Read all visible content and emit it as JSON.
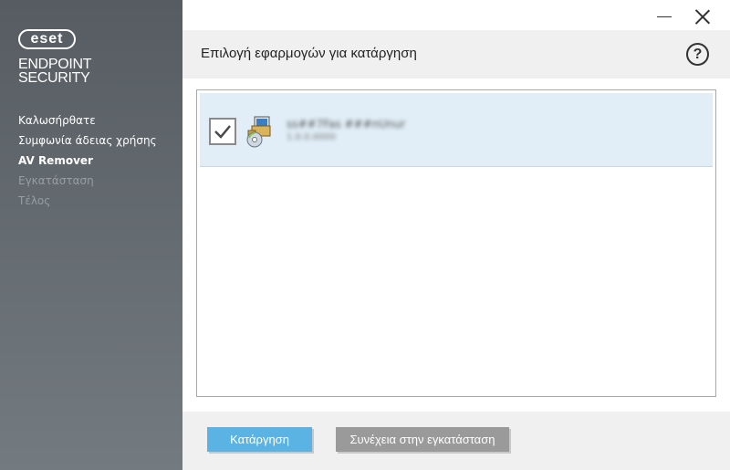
{
  "sidebar": {
    "logo": {
      "badge": "eset",
      "line1": "ENDPOINT",
      "line2": "SECURITY"
    },
    "steps": [
      {
        "label": "Καλωσήρθατε",
        "state": "done"
      },
      {
        "label": "Συμφωνία άδειας χρήσης",
        "state": "done"
      },
      {
        "label": "AV Remover",
        "state": "current"
      },
      {
        "label": "Εγκατάσταση",
        "state": "inactive"
      },
      {
        "label": "Τέλος",
        "state": "inactive"
      }
    ]
  },
  "window": {
    "minimize_icon": "minimize-icon",
    "close_icon": "close-icon"
  },
  "header": {
    "title": "Επιλογή εφαρμογών για κατάργηση",
    "help_glyph": "?"
  },
  "app_list": {
    "items": [
      {
        "name": "ss##7Fas ###nUnur",
        "version": "1.0.0.0000",
        "checked": true,
        "icon": "installer-package-icon"
      }
    ]
  },
  "footer": {
    "remove_label": "Κατάργηση",
    "continue_label": "Συνέχεια στην εγκατάσταση"
  },
  "colors": {
    "sidebar_top": "#565c62",
    "sidebar_bottom": "#737a80",
    "selected_row": "#e1eef7",
    "primary_button": "#5ab3e3",
    "secondary_button": "#9a9a9a"
  }
}
